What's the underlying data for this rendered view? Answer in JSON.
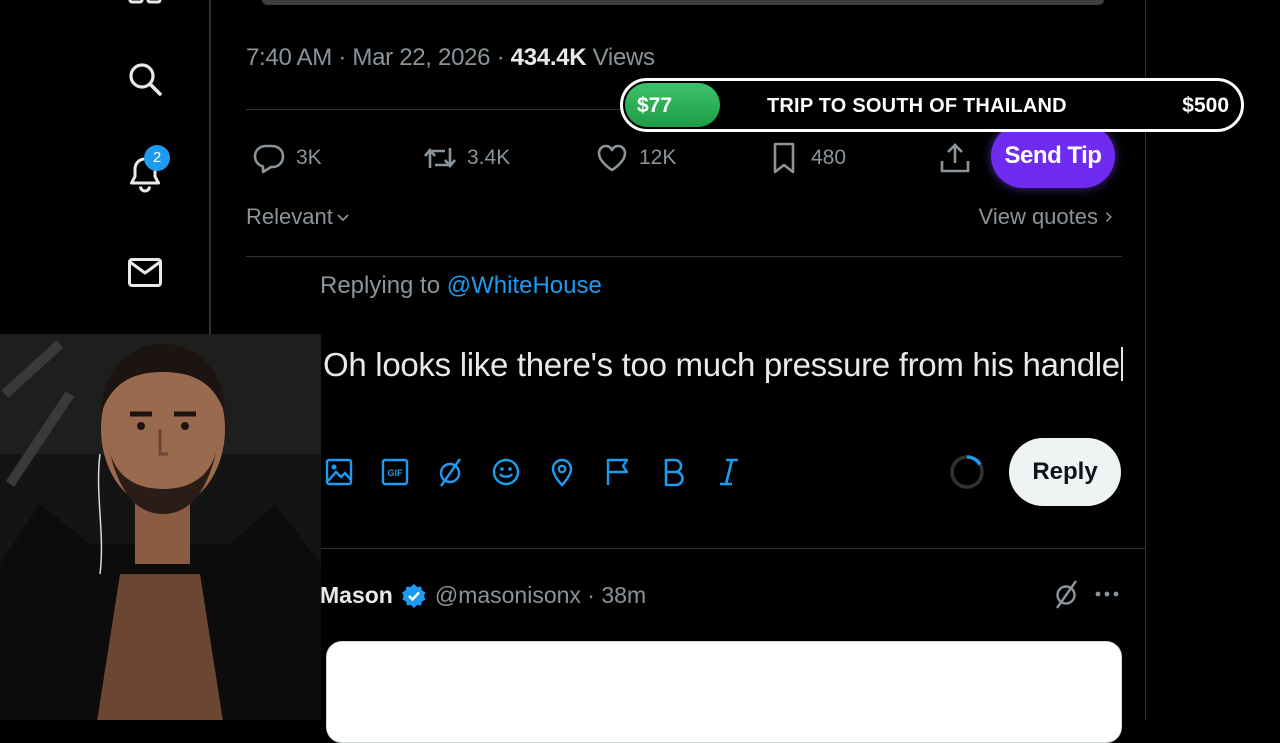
{
  "sidenav": {
    "notification_count": "2",
    "icons": [
      "search-icon",
      "bell-icon",
      "mail-icon"
    ]
  },
  "tweet": {
    "time": "7:40 AM",
    "separator": " · ",
    "date": "Mar 22, 2026",
    "views_count": "434.4K",
    "views_label": "Views",
    "actions": {
      "replies": "3K",
      "reposts": "3.4K",
      "likes": "12K",
      "bookmarks": "480"
    },
    "send_tip_label": "Send Tip",
    "sort_label": "Relevant",
    "view_quotes_label": "View quotes"
  },
  "goal": {
    "current": "$77",
    "title": "TRIP TO SOUTH OF THAILAND",
    "target": "$500",
    "progress_fraction": 0.154,
    "fill_color": "#2bb35a"
  },
  "composer": {
    "replying_prefix": "Replying to",
    "replying_handle": "@WhiteHouse",
    "text": "Oh looks like there's too much pressure from his handle",
    "toolbar": [
      "image-icon",
      "gif-icon",
      "grok-icon",
      "emoji-icon",
      "location-icon",
      "flag-icon",
      "bold-icon",
      "italic-icon"
    ],
    "reply_label": "Reply"
  },
  "next_tweet": {
    "author_name": "Mason",
    "author_meta": "@masonisonx · 38m"
  },
  "colors": {
    "accent": "#1d9bf0",
    "tip": "#6f2bf0",
    "muted": "#8b949a"
  }
}
